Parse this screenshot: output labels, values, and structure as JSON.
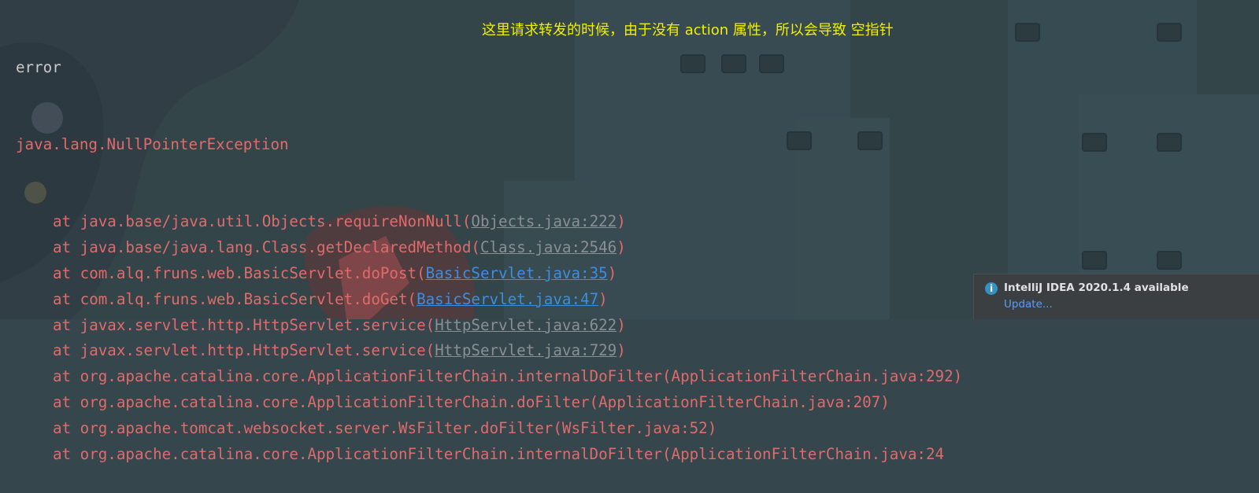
{
  "console": {
    "error_word": "error",
    "exception": "java.lang.NullPointerException",
    "frames": [
      {
        "prefix": "at java.base/java.util.Objects.requireNonNull(",
        "link": "Objects.java:222",
        "suffix": ")",
        "link_kind": "lib"
      },
      {
        "prefix": "at java.base/java.lang.Class.getDeclaredMethod(",
        "link": "Class.java:2546",
        "suffix": ")",
        "link_kind": "lib"
      },
      {
        "prefix": "at com.alq.fruns.web.BasicServlet.doPost(",
        "link": "BasicServlet.java:35",
        "suffix": ")",
        "link_kind": "user"
      },
      {
        "prefix": "at com.alq.fruns.web.BasicServlet.doGet(",
        "link": "BasicServlet.java:47",
        "suffix": ")",
        "link_kind": "user"
      },
      {
        "prefix": "at javax.servlet.http.HttpServlet.service(",
        "link": "HttpServlet.java:622",
        "suffix": ")",
        "link_kind": "lib"
      },
      {
        "prefix": "at javax.servlet.http.HttpServlet.service(",
        "link": "HttpServlet.java:729",
        "suffix": ")",
        "link_kind": "lib"
      },
      {
        "prefix": "at org.apache.catalina.core.ApplicationFilterChain.internalDoFilter(",
        "link": "ApplicationFilterChain.java:292",
        "suffix": ")",
        "link_kind": "plain"
      },
      {
        "prefix": "at org.apache.catalina.core.ApplicationFilterChain.doFilter(",
        "link": "ApplicationFilterChain.java:207",
        "suffix": ")",
        "link_kind": "plain"
      },
      {
        "prefix": "at org.apache.tomcat.websocket.server.WsFilter.doFilter(",
        "link": "WsFilter.java:52",
        "suffix": ")",
        "link_kind": "plain"
      },
      {
        "prefix": "at org.apache.catalina.core.ApplicationFilterChain.internalDoFilter(",
        "link": "ApplicationFilterChain.java:24",
        "suffix": "",
        "link_kind": "plain"
      }
    ]
  },
  "annotation": "这里请求转发的时候，由于没有 action 属性，所以会导致 空指针",
  "notification": {
    "icon": "info-icon",
    "title": "IntelliJ IDEA 2020.1.4 available",
    "action": "Update..."
  },
  "colors": {
    "console_bg": "#35464c",
    "exception_text": "#e06b6b",
    "error_word": "#c7c9cb",
    "user_link": "#3d8de0",
    "lib_link": "#8a8f92",
    "annotation": "#f0f000",
    "notification_bg": "#3c3f41",
    "notification_link": "#589df6"
  }
}
